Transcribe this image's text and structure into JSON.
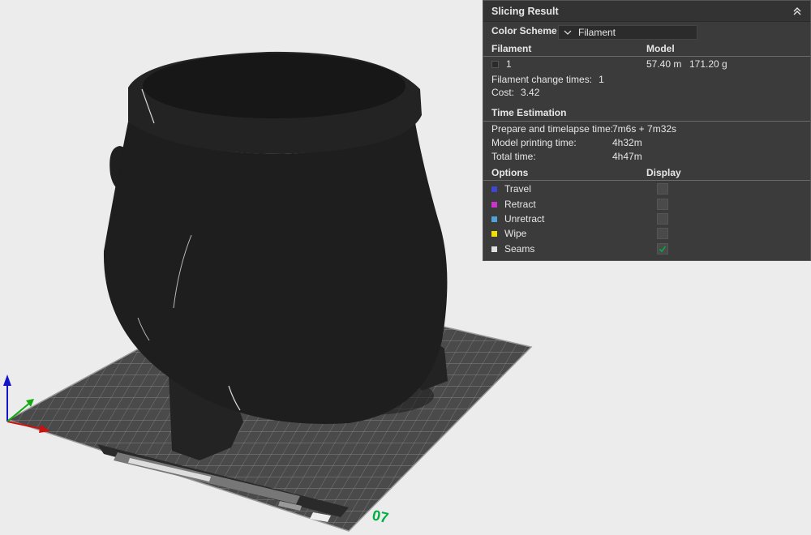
{
  "viewport": {
    "plate_label": "07"
  },
  "panel": {
    "title": "Slicing Result",
    "color_scheme": {
      "label": "Color Scheme",
      "value": "Filament"
    },
    "filament_table": {
      "headers": [
        "Filament",
        "Model"
      ],
      "rows": [
        {
          "index": "1",
          "length": "57.40 m",
          "weight": "171.20 g",
          "color": "#2a2a2a"
        }
      ]
    },
    "filament_change": {
      "label": "Filament change times:",
      "value": "1"
    },
    "cost": {
      "label": "Cost:",
      "value": "3.42"
    },
    "time_estimation": {
      "title": "Time Estimation",
      "rows": [
        {
          "label": "Prepare and timelapse time:",
          "value": "7m6s + 7m32s"
        },
        {
          "label": "Model printing time:",
          "value": "4h32m"
        },
        {
          "label": "Total time:",
          "value": "4h47m"
        }
      ]
    },
    "options": {
      "headers": [
        "Options",
        "Display"
      ],
      "items": [
        {
          "label": "Travel",
          "color": "#3f48cc",
          "checked": false
        },
        {
          "label": "Retract",
          "color": "#cc33cc",
          "checked": false
        },
        {
          "label": "Unretract",
          "color": "#4fa3d9",
          "checked": false
        },
        {
          "label": "Wipe",
          "color": "#f0e000",
          "checked": false
        },
        {
          "label": "Seams",
          "color": "#e0e0e0",
          "checked": true
        }
      ]
    }
  },
  "colors": {
    "accent": "#00ae42",
    "panel_bg": "#3b3b3b"
  }
}
